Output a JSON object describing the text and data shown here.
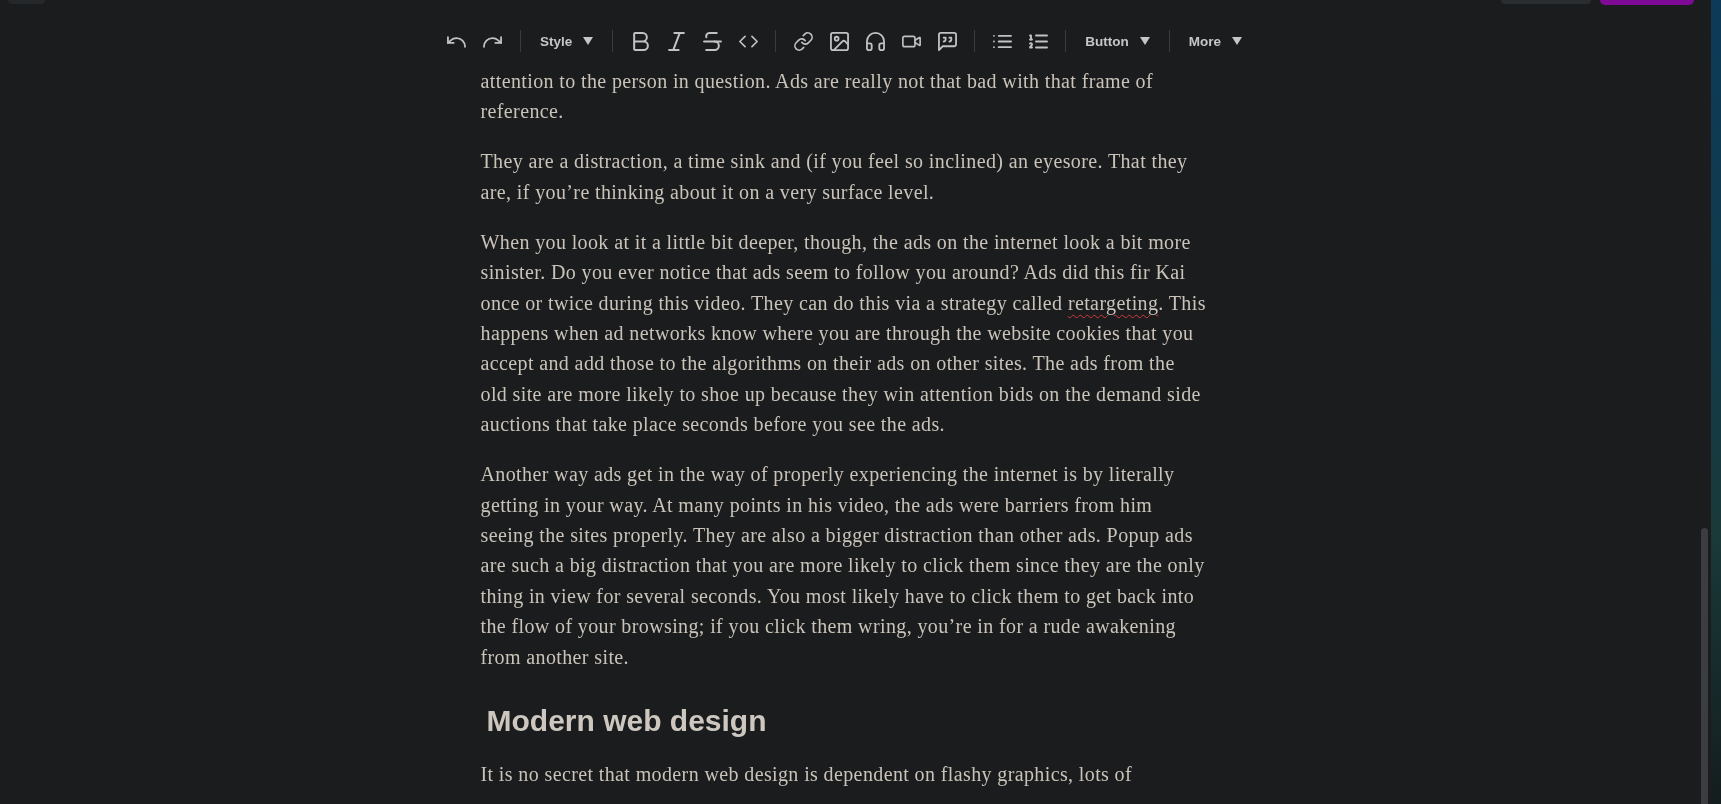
{
  "toolbar": {
    "style_dropdown": {
      "label": "Style"
    },
    "button_dropdown": {
      "label": "Button"
    },
    "more_dropdown": {
      "label": "More"
    }
  },
  "document": {
    "blocks": [
      {
        "kind": "paragraph",
        "segments": [
          {
            "text": "attention to the person in question. Ads are really not that bad with that frame of reference.",
            "misspelled": false
          }
        ]
      },
      {
        "kind": "paragraph",
        "segments": [
          {
            "text": "They are a distraction, a time sink and (if you feel so inclined) an eyesore. That they are, if you’re thinking about it on a very surface level.",
            "misspelled": false
          }
        ]
      },
      {
        "kind": "paragraph",
        "segments": [
          {
            "text": "When you look at it a little bit deeper, though, the ads on the internet look a bit more sinister. Do you ever notice that ads seem to follow you around? Ads did this fir Kai once or twice during this video. They can do this via a strategy called ",
            "misspelled": false
          },
          {
            "text": "retargeting",
            "misspelled": true
          },
          {
            "text": ". This happens when ad networks know where you are through the website cookies that you accept and add those to the algorithms on their ads on other sites. The ads from the old site are more likely to shoe up because they win attention bids on the demand side auctions that take place seconds before you see the ads.",
            "misspelled": false
          }
        ]
      },
      {
        "kind": "paragraph",
        "segments": [
          {
            "text": "Another way ads get in the way of properly experiencing the internet is by literally getting in your way. At many points in his video, the ads were barriers from him seeing the sites properly. They are also a bigger distraction than other ads. Popup ads are such a big distraction that you are more likely to click them since they are the only thing in view for several seconds. You most likely have to click them to get back into the flow of your browsing; if you click them wring, you’re in for a rude awakening from another site.",
            "misspelled": false
          }
        ]
      },
      {
        "kind": "heading",
        "text": "Modern web design"
      },
      {
        "kind": "paragraph",
        "segments": [
          {
            "text": "It is no secret that modern web design is dependent on flashy graphics, lots of",
            "misspelled": false
          }
        ]
      }
    ]
  }
}
